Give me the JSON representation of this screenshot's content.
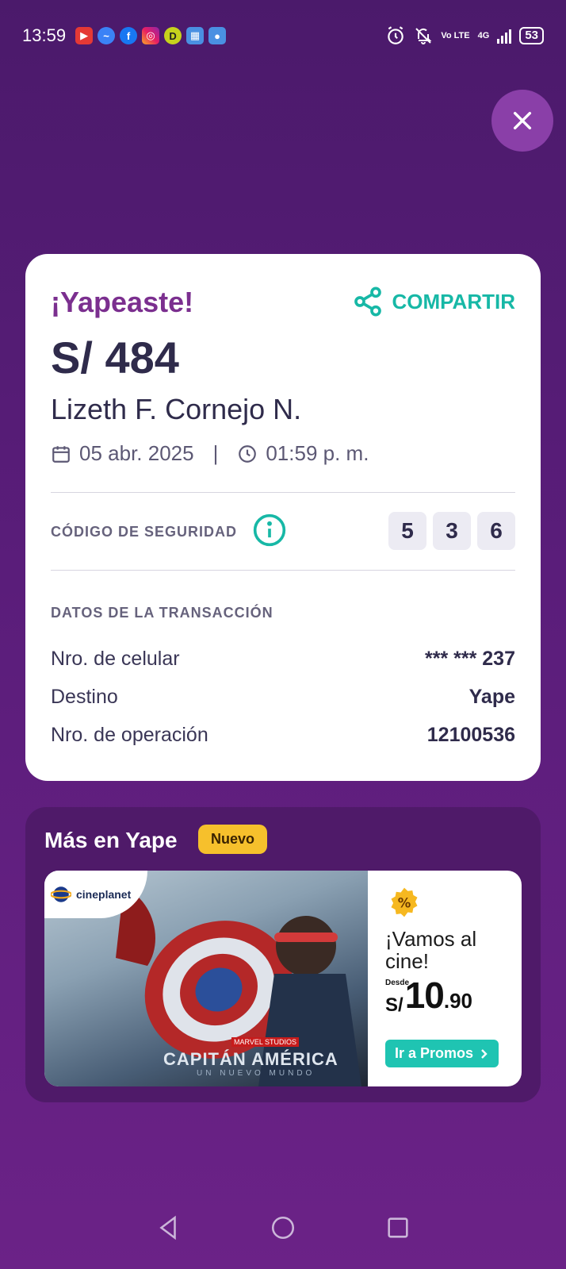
{
  "status_bar": {
    "time": "13:59",
    "battery": "53",
    "network": "4G",
    "volte": "Vo LTE",
    "app_icons": [
      "youtube-icon",
      "messenger-icon",
      "facebook-icon",
      "instagram-icon",
      "d-app-icon",
      "calendar-app-icon",
      "maps-icon"
    ]
  },
  "receipt": {
    "title": "¡Yapeaste!",
    "share_label": "COMPARTIR",
    "amount": "S/ 484",
    "recipient": "Lizeth F. Cornejo N.",
    "date": "05 abr. 2025",
    "separator": "|",
    "time": "01:59 p. m.",
    "security_label": "CÓDIGO DE SEGURIDAD",
    "security_code": [
      "5",
      "3",
      "6"
    ],
    "transaction_title": "DATOS DE LA TRANSACCIÓN",
    "rows": [
      {
        "label": "Nro. de celular",
        "value": "*** *** 237"
      },
      {
        "label": "Destino",
        "value": "Yape"
      },
      {
        "label": "Nro. de operación",
        "value": "12100536"
      }
    ]
  },
  "more": {
    "title": "Más en Yape",
    "badge": "Nuevo",
    "promo": {
      "brand": "cineplanet",
      "movie_studio": "MARVEL STUDIOS",
      "movie_title": "CAPITÁN AMÉRICA",
      "movie_subtitle": "UN NUEVO MUNDO",
      "headline": "¡Vamos al cine!",
      "price_prefix": "Desde",
      "currency": "S/",
      "price_int": "10",
      "price_dec": ".90",
      "cta": "Ir a Promos"
    }
  },
  "colors": {
    "accent_purple": "#7b2f8f",
    "teal": "#17b8a6",
    "badge_yellow": "#f6c02c"
  }
}
